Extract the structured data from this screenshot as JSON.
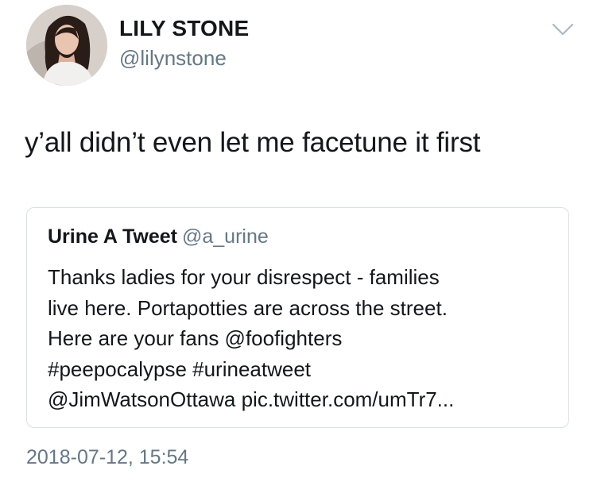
{
  "author": {
    "name": "LILY STONE",
    "handle": "@lilynstone"
  },
  "icons": {
    "avatar": "profile-photo",
    "menu": "chevron-down-icon"
  },
  "tweet": {
    "text": "y’all didn’t even let me facetune it first",
    "timestamp": "2018-07-12, 15:54"
  },
  "quoted_tweet": {
    "name": "Urine A Tweet",
    "handle": "@a_urine",
    "lines": [
      "Thanks ladies for your disrespect - families",
      "live here. Portapotties are across the street.",
      "Here are your fans @foofighters",
      "#peepocalypse #urineatweet",
      "@JimWatsonOttawa pic.twitter.com/umTr7..."
    ]
  },
  "colors": {
    "text_primary": "#14171a",
    "text_secondary": "#657786",
    "border": "#d9e1e8",
    "chevron": "#aab8c2"
  }
}
